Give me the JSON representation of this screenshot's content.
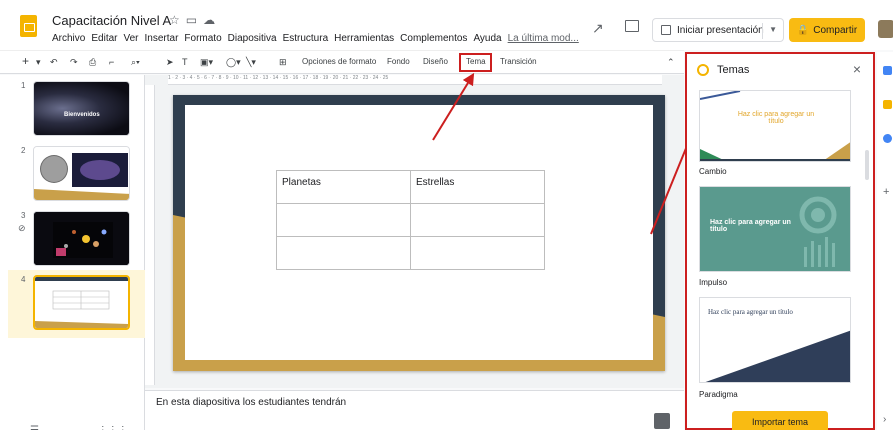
{
  "header": {
    "doc_title": "Capacitación Nivel A",
    "menu": [
      "Archivo",
      "Editar",
      "Ver",
      "Insertar",
      "Formato",
      "Diapositiva",
      "Estructura",
      "Herramientas",
      "Complementos",
      "Ayuda"
    ],
    "last_edit": "La última mod...",
    "present_label": "Iniciar presentación",
    "share_label": "Compartir",
    "icons": [
      "star-icon",
      "folder-icon",
      "cloud-icon",
      "trend-icon",
      "comment-icon"
    ]
  },
  "toolbar": {
    "format_options": "Opciones de formato",
    "background": "Fondo",
    "layout": "Diseño",
    "theme": "Tema",
    "transition": "Transición"
  },
  "filmstrip": {
    "slides": [
      {
        "number": "1",
        "title": "Bienvenidos"
      },
      {
        "number": "2"
      },
      {
        "number": "3"
      },
      {
        "number": "4"
      }
    ],
    "selected_index": 4,
    "thumb4_cells": [
      "Planets",
      "Estrellas"
    ]
  },
  "slide": {
    "table": [
      [
        "Planetas",
        "Estrellas"
      ],
      [
        "",
        ""
      ],
      [
        "",
        ""
      ]
    ]
  },
  "notes": {
    "text": "En esta diapositiva los estudiantes tendrán"
  },
  "themes_panel": {
    "title": "Temas",
    "themes": [
      {
        "name": "Cambio",
        "placeholder": "Haz clic para agregar un título",
        "accent": "#f4b400"
      },
      {
        "name": "Impulso",
        "placeholder": "Haz clic para agregar un título",
        "accent": "#5a9a8e"
      },
      {
        "name": "Paradigma",
        "placeholder": "Haz clic para agregar un título",
        "accent": "#2f3e59"
      }
    ],
    "import_label": "Importar tema"
  },
  "ruler_ticks": "1 · 2 · 3 · 4 · 5 · 6 · 7 · 8 · 9 · 10 · 11 · 12 · 13 · 14 · 15 · 16 · 17 · 18 · 19 · 20 · 21 · 22 · 23 · 24 · 25",
  "colors": {
    "accent_yellow": "#f9bb12",
    "highlight_red": "#cc1f1f",
    "slide_dark": "#2f3e4e",
    "slide_gold": "#c9a04a"
  }
}
